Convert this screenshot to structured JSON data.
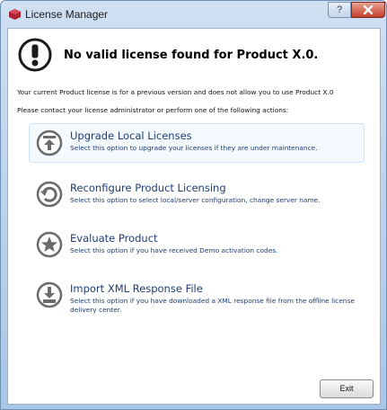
{
  "window": {
    "title": "License Manager",
    "help_label": "?"
  },
  "header": {
    "title": "No valid license found for Product X.0."
  },
  "info": {
    "line1": "Your current Product license is for a previous version and does not allow you to use Product X.0",
    "line2": "Please contact your license administrator or perform one of the following actions:"
  },
  "options": [
    {
      "title": "Upgrade Local Licenses",
      "description": "Select this option to upgrade your licenses if they are under maintenance.",
      "icon": "upgrade-icon"
    },
    {
      "title": "Reconfigure Product Licensing",
      "description": "Select this option to select local/server configuration, change server name.",
      "icon": "reconfigure-icon"
    },
    {
      "title": "Evaluate Product",
      "description": "Select this option if you have received Demo activation codes.",
      "icon": "star-icon"
    },
    {
      "title": "Import XML Response File",
      "description": "Select this option if you have downloaded a XML response file from the offline license delivery center.",
      "icon": "import-icon"
    }
  ],
  "footer": {
    "exit_label": "Exit"
  },
  "colors": {
    "link_text": "#1f3d73",
    "icon_gray": "#6b6b6b",
    "close_button": "#c3402b"
  }
}
